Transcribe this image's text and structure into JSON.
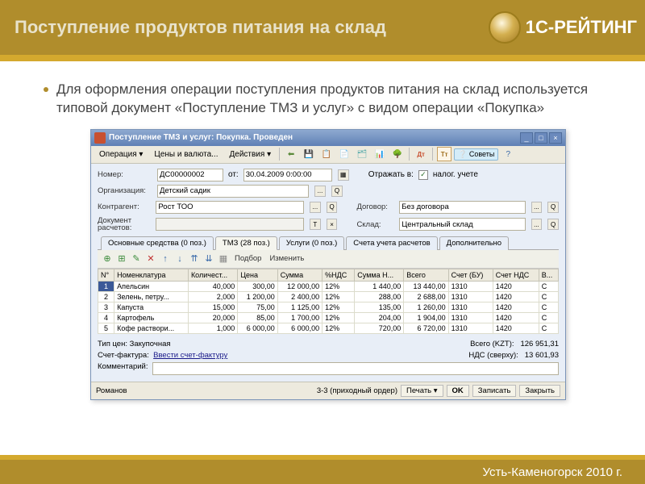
{
  "slide": {
    "title": "Поступление продуктов питания на склад",
    "logo_text": "1С-РЕЙТИНГ",
    "bullet": "Для оформления операции поступления продуктов питания на склад используется типовой документ «Поступление ТМЗ и услуг» с видом операции «Покупка»",
    "footer": "Усть-Каменогорск 2010 г."
  },
  "window": {
    "title": "Поступление ТМЗ и услуг: Покупка. Проведен",
    "menu": {
      "op": "Операция",
      "price": "Цены и валюта...",
      "act": "Действия",
      "sovety": "Советы"
    },
    "form": {
      "number_label": "Номер:",
      "number": "ДС00000002",
      "ot": "от:",
      "date": "30.04.2009 0:00:00",
      "reflect_label": "Отражать в:",
      "tax_label": "налог. учете",
      "org_label": "Организация:",
      "org": "Детский садик",
      "contr_label": "Контрагент:",
      "contr": "Рост ТОО",
      "dog_label": "Договор:",
      "dog": "Без договора",
      "docras_label": "Документ расчетов:",
      "docras": "",
      "sklad_label": "Склад:",
      "sklad": "Центральный склад"
    },
    "tabs": [
      "Основные средства (0 поз.)",
      "ТМЗ (28 поз.)",
      "Услуги (0 поз.)",
      "Счета учета расчетов",
      "Дополнительно"
    ],
    "podbor": "Подбор",
    "izmenit": "Изменить",
    "grid": {
      "headers": [
        "N°",
        "Номенклатура",
        "Количест...",
        "Цена",
        "Сумма",
        "%НДС",
        "Сумма Н...",
        "Всего",
        "Счет (БУ)",
        "Счет НДС",
        "В..."
      ],
      "rows": [
        [
          "1",
          "Апельсин",
          "40,000",
          "300,00",
          "12 000,00",
          "12%",
          "1 440,00",
          "13 440,00",
          "1310",
          "1420",
          "С"
        ],
        [
          "2",
          "Зелень, петру...",
          "2,000",
          "1 200,00",
          "2 400,00",
          "12%",
          "288,00",
          "2 688,00",
          "1310",
          "1420",
          "С"
        ],
        [
          "3",
          "Капуста",
          "15,000",
          "75,00",
          "1 125,00",
          "12%",
          "135,00",
          "1 260,00",
          "1310",
          "1420",
          "С"
        ],
        [
          "4",
          "Картофель",
          "20,000",
          "85,00",
          "1 700,00",
          "12%",
          "204,00",
          "1 904,00",
          "1310",
          "1420",
          "С"
        ],
        [
          "5",
          "Кофе раствори...",
          "1,000",
          "6 000,00",
          "6 000,00",
          "12%",
          "720,00",
          "6 720,00",
          "1310",
          "1420",
          "С"
        ]
      ]
    },
    "bottom": {
      "tip_label": "Тип цен: Закупочная",
      "vsego_label": "Всего (KZT):",
      "vsego": "126 951,31",
      "sf_label": "Счет-фактура:",
      "sf_link": "Ввести счет-фактуру",
      "nds_label": "НДС (сверху):",
      "nds": "13 601,93",
      "comm_label": "Комментарий:"
    },
    "status": {
      "user": "Романов",
      "extra": "3-3 (приходный ордер)",
      "print": "Печать",
      "ok": "OK",
      "save": "Записать",
      "close": "Закрыть"
    }
  }
}
